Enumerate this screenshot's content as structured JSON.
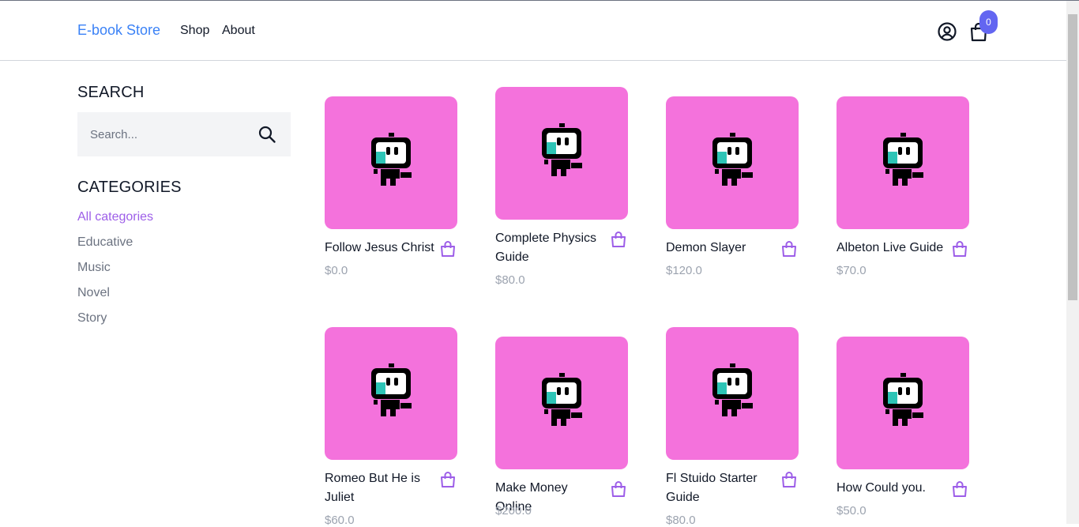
{
  "header": {
    "brand": "E-book Store",
    "nav": [
      "Shop",
      "About"
    ],
    "cart_count": "0",
    "account_icon": "user-circle-icon",
    "cart_icon": "shopping-bag-icon"
  },
  "sidebar": {
    "search_title": "SEARCH",
    "search_placeholder": "Search...",
    "search_icon": "search-icon",
    "categories_title": "CATEGORIES",
    "categories": [
      "All categories",
      "Educative",
      "Music",
      "Novel",
      "Story"
    ],
    "active_category": "All categories"
  },
  "colors": {
    "brand": "#3b82f6",
    "accent": "#9d5ee8",
    "card_background": "#f472dc",
    "badge": "#6366f1",
    "price": "#9ca3af"
  },
  "products": [
    {
      "title": "Follow Jesus Christ",
      "price": "$0.0"
    },
    {
      "title": "Complete Physics Guide",
      "price": "$80.0"
    },
    {
      "title": "Demon Slayer",
      "price": "$120.0"
    },
    {
      "title": "Albeton Live Guide",
      "price": "$70.0"
    },
    {
      "title": "Romeo But He is Juliet",
      "price": "$60.0"
    },
    {
      "title": "Make Money Online",
      "price": "$200.0"
    },
    {
      "title": "Fl Stuido Starter Guide",
      "price": "$80.0"
    },
    {
      "title": "How Could you.",
      "price": "$50.0"
    }
  ]
}
